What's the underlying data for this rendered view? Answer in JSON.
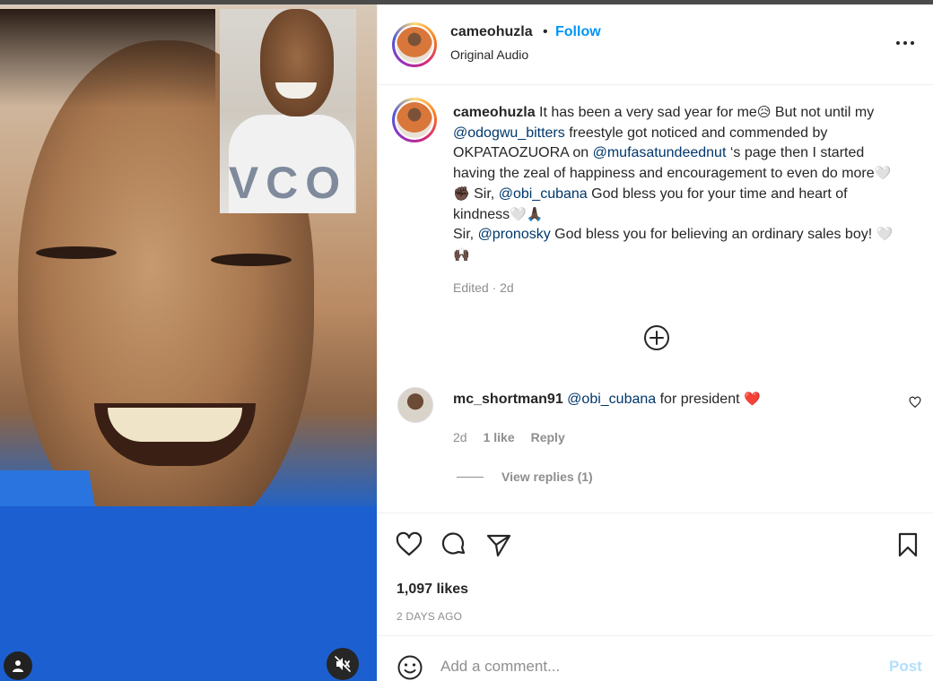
{
  "header": {
    "username": "cameohuzla",
    "separator": "•",
    "follow_label": "Follow",
    "audio_label": "Original Audio"
  },
  "caption": {
    "username": "cameohuzla",
    "t1": " It has been a very sad year for me",
    "e1": "😥",
    "t2": " But not until my ",
    "m1": "@odogwu_bitters",
    "t3": " freestyle got noticed and commended by OKPATAOZUORA on ",
    "m2": "@mufasatundeednut",
    "t4": " ‘s page then I started having the zeal of happiness and encouragement to even do more",
    "e2": "🤍✊🏿",
    "t5": " Sir, ",
    "m3": "@obi_cubana",
    "t6": " God bless you for your time and heart of kindness",
    "e3": "🤍🙏🏿",
    "t7": "Sir, ",
    "m4": "@pronosky",
    "t8": " God bless you for believing an ordinary sales boy! ",
    "e4": "🤍🙌🏿",
    "edited": "Edited · 2d"
  },
  "comment": {
    "username": "mc_shortman91",
    "mention": "@obi_cubana",
    "text": " for president ",
    "emoji": "❤️",
    "time": "2d",
    "likes": "1 like",
    "reply_label": "Reply",
    "view_replies": "View replies (1)"
  },
  "actions": {
    "likes": "1,097 likes",
    "date": "2 DAYS AGO"
  },
  "add_comment": {
    "placeholder": "Add a comment...",
    "post_label": "Post"
  },
  "icons": {
    "like": "heart-icon",
    "comment": "comment-icon",
    "share": "share-icon",
    "save": "bookmark-icon",
    "emoji": "emoji-icon",
    "more": "more-options-icon",
    "add": "plus-circle-icon",
    "mute": "volume-muted-icon",
    "tags": "user-tag-icon"
  },
  "colors": {
    "follow": "#0095f6",
    "mention": "#00376b",
    "muted_text": "#8e8e8e",
    "post_disabled": "#b2dffc",
    "heart_red": "#ed4956"
  }
}
